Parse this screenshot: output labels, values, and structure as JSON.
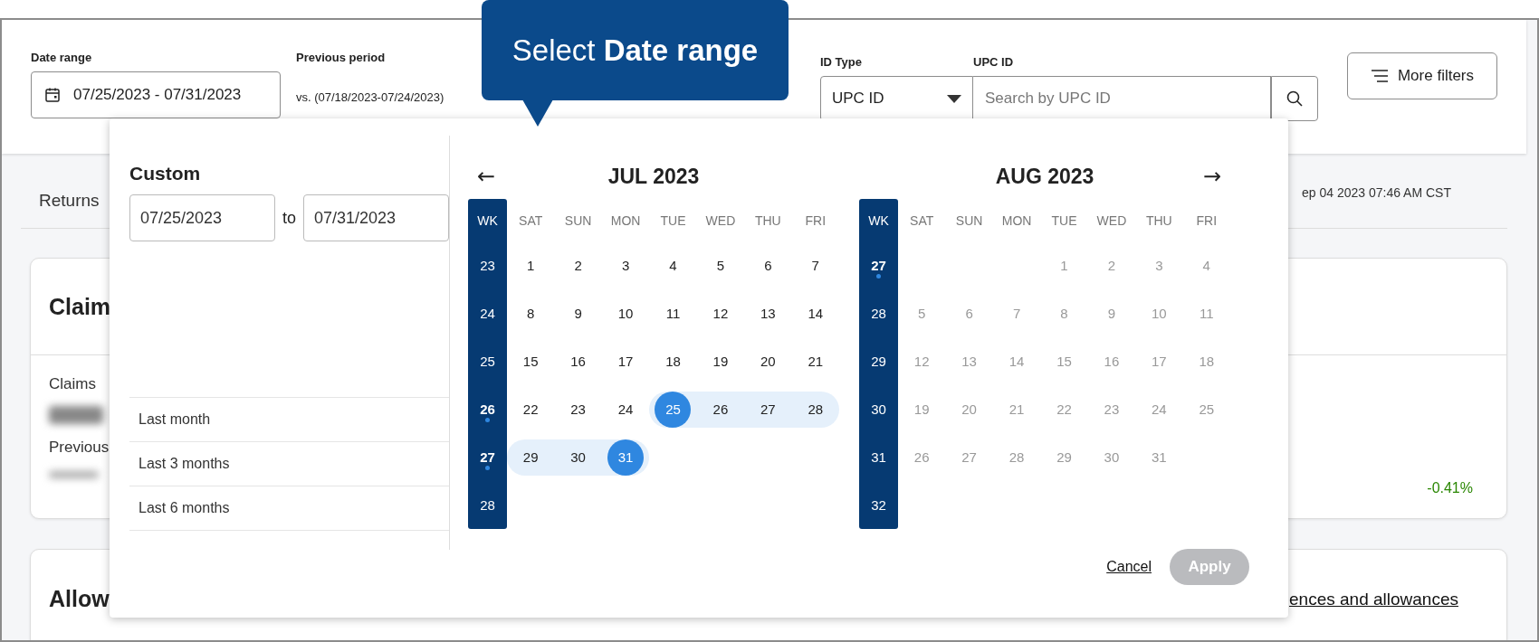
{
  "filters": {
    "date_range": {
      "label": "Date range",
      "value": "07/25/2023 - 07/31/2023"
    },
    "previous_period": {
      "label": "Previous period",
      "value": "vs. (07/18/2023-07/24/2023)"
    },
    "id_type": {
      "label": "ID Type",
      "value": "UPC ID"
    },
    "upc_id": {
      "label": "UPC ID",
      "placeholder": "Search by UPC ID"
    },
    "more_filters": "More filters"
  },
  "tooltip": "Select **Date range**",
  "tabs_row": {
    "tab": "Returns",
    "updated": "ep 04 2023 07:46 AM CST"
  },
  "claims_card": {
    "title": "Claim",
    "metric_label": "Claims",
    "previous_label": "Previous",
    "change": "-0.41%"
  },
  "allowances_card": {
    "title": "Allow",
    "link": "ences and allowances"
  },
  "date_picker": {
    "custom_title": "Custom",
    "from": "07/25/2023",
    "to_label": "to",
    "to": "07/31/2023",
    "presets": [
      {
        "label": "Last month",
        "selected": false
      },
      {
        "label": "Last 3 months",
        "selected": false
      },
      {
        "label": "Last 6 months",
        "selected": false
      }
    ],
    "months": [
      {
        "title": "JUL 2023",
        "nav": {
          "kind": "prev",
          "label": "←"
        },
        "week_header": "WK",
        "weekdays": [
          "SAT",
          "SUN",
          "MON",
          "TUE",
          "WED",
          "THU",
          "FRI"
        ],
        "weeks": [
          {
            "number": "23",
            "current": false,
            "days": [
              {
                "kind": "day",
                "label": "1",
                "selected": false,
                "in_range": false,
                "disabled": false
              },
              {
                "kind": "day",
                "label": "2",
                "selected": false,
                "in_range": false,
                "disabled": false
              },
              {
                "kind": "day",
                "label": "3",
                "selected": false,
                "in_range": false,
                "disabled": false
              },
              {
                "kind": "day",
                "label": "4",
                "selected": false,
                "in_range": false,
                "disabled": false
              },
              {
                "kind": "day",
                "label": "5",
                "selected": false,
                "in_range": false,
                "disabled": false
              },
              {
                "kind": "day",
                "label": "6",
                "selected": false,
                "in_range": false,
                "disabled": false
              },
              {
                "kind": "day",
                "label": "7",
                "selected": false,
                "in_range": false,
                "disabled": false
              }
            ]
          },
          {
            "number": "24",
            "current": false,
            "days": [
              {
                "kind": "day",
                "label": "8",
                "selected": false,
                "in_range": false,
                "disabled": false
              },
              {
                "kind": "day",
                "label": "9",
                "selected": false,
                "in_range": false,
                "disabled": false
              },
              {
                "kind": "day",
                "label": "10",
                "selected": false,
                "in_range": false,
                "disabled": false
              },
              {
                "kind": "day",
                "label": "11",
                "selected": false,
                "in_range": false,
                "disabled": false
              },
              {
                "kind": "day",
                "label": "12",
                "selected": false,
                "in_range": false,
                "disabled": false
              },
              {
                "kind": "day",
                "label": "13",
                "selected": false,
                "in_range": false,
                "disabled": false
              },
              {
                "kind": "day",
                "label": "14",
                "selected": false,
                "in_range": false,
                "disabled": false
              }
            ]
          },
          {
            "number": "25",
            "current": false,
            "days": [
              {
                "kind": "day",
                "label": "15",
                "selected": false,
                "in_range": false,
                "disabled": false
              },
              {
                "kind": "day",
                "label": "16",
                "selected": false,
                "in_range": false,
                "disabled": false
              },
              {
                "kind": "day",
                "label": "17",
                "selected": false,
                "in_range": false,
                "disabled": false
              },
              {
                "kind": "day",
                "label": "18",
                "selected": false,
                "in_range": false,
                "disabled": false
              },
              {
                "kind": "day",
                "label": "19",
                "selected": false,
                "in_range": false,
                "disabled": false
              },
              {
                "kind": "day",
                "label": "20",
                "selected": false,
                "in_range": false,
                "disabled": false
              },
              {
                "kind": "day",
                "label": "21",
                "selected": false,
                "in_range": false,
                "disabled": false
              }
            ]
          },
          {
            "number": "26",
            "current": true,
            "days": [
              {
                "kind": "day",
                "label": "22",
                "selected": false,
                "in_range": false,
                "disabled": false
              },
              {
                "kind": "day",
                "label": "23",
                "selected": false,
                "in_range": false,
                "disabled": false
              },
              {
                "kind": "day",
                "label": "24",
                "selected": false,
                "in_range": false,
                "disabled": false
              },
              {
                "kind": "day",
                "label": "25",
                "selected": true,
                "in_range": true,
                "disabled": false
              },
              {
                "kind": "day",
                "label": "26",
                "selected": false,
                "in_range": true,
                "disabled": false
              },
              {
                "kind": "day",
                "label": "27",
                "selected": false,
                "in_range": true,
                "disabled": false
              },
              {
                "kind": "day",
                "label": "28",
                "selected": false,
                "in_range": true,
                "disabled": false
              }
            ]
          },
          {
            "number": "27",
            "current": true,
            "days": [
              {
                "kind": "day",
                "label": "29",
                "selected": false,
                "in_range": true,
                "disabled": false
              },
              {
                "kind": "day",
                "label": "30",
                "selected": false,
                "in_range": true,
                "disabled": false
              },
              {
                "kind": "day",
                "label": "31",
                "selected": true,
                "in_range": true,
                "disabled": false
              }
            ]
          },
          {
            "number": "28",
            "current": false
          }
        ]
      },
      {
        "title": "AUG 2023",
        "nav": {
          "kind": "next",
          "label": "→"
        },
        "week_header": "WK",
        "weekdays": [
          "SAT",
          "SUN",
          "MON",
          "TUE",
          "WED",
          "THU",
          "FRI"
        ],
        "weeks": [
          {
            "number": "27",
            "current": true,
            "days": [
              {
                "kind": "blank"
              },
              {
                "kind": "blank"
              },
              {
                "kind": "blank"
              },
              {
                "kind": "day",
                "label": "1",
                "selected": false,
                "in_range": false,
                "disabled": true
              },
              {
                "kind": "day",
                "label": "2",
                "selected": false,
                "in_range": false,
                "disabled": true
              },
              {
                "kind": "day",
                "label": "3",
                "selected": false,
                "in_range": false,
                "disabled": true
              },
              {
                "kind": "day",
                "label": "4",
                "selected": false,
                "in_range": false,
                "disabled": true
              }
            ]
          },
          {
            "number": "28",
            "current": false,
            "days": [
              {
                "kind": "day",
                "label": "5",
                "selected": false,
                "in_range": false,
                "disabled": true
              },
              {
                "kind": "day",
                "label": "6",
                "selected": false,
                "in_range": false,
                "disabled": true
              },
              {
                "kind": "day",
                "label": "7",
                "selected": false,
                "in_range": false,
                "disabled": true
              },
              {
                "kind": "day",
                "label": "8",
                "selected": false,
                "in_range": false,
                "disabled": true
              },
              {
                "kind": "day",
                "label": "9",
                "selected": false,
                "in_range": false,
                "disabled": true
              },
              {
                "kind": "day",
                "label": "10",
                "selected": false,
                "in_range": false,
                "disabled": true
              },
              {
                "kind": "day",
                "label": "11",
                "selected": false,
                "in_range": false,
                "disabled": true
              }
            ]
          },
          {
            "number": "29",
            "current": false,
            "days": [
              {
                "kind": "day",
                "label": "12",
                "selected": false,
                "in_range": false,
                "disabled": true
              },
              {
                "kind": "day",
                "label": "13",
                "selected": false,
                "in_range": false,
                "disabled": true
              },
              {
                "kind": "day",
                "label": "14",
                "selected": false,
                "in_range": false,
                "disabled": true
              },
              {
                "kind": "day",
                "label": "15",
                "selected": false,
                "in_range": false,
                "disabled": true
              },
              {
                "kind": "day",
                "label": "16",
                "selected": false,
                "in_range": false,
                "disabled": true
              },
              {
                "kind": "day",
                "label": "17",
                "selected": false,
                "in_range": false,
                "disabled": true
              },
              {
                "kind": "day",
                "label": "18",
                "selected": false,
                "in_range": false,
                "disabled": true
              }
            ]
          },
          {
            "number": "30",
            "current": false,
            "days": [
              {
                "kind": "day",
                "label": "19",
                "selected": false,
                "in_range": false,
                "disabled": true
              },
              {
                "kind": "day",
                "label": "20",
                "selected": false,
                "in_range": false,
                "disabled": true
              },
              {
                "kind": "day",
                "label": "21",
                "selected": false,
                "in_range": false,
                "disabled": true
              },
              {
                "kind": "day",
                "label": "22",
                "selected": false,
                "in_range": false,
                "disabled": true
              },
              {
                "kind": "day",
                "label": "23",
                "selected": false,
                "in_range": false,
                "disabled": true
              },
              {
                "kind": "day",
                "label": "24",
                "selected": false,
                "in_range": false,
                "disabled": true
              },
              {
                "kind": "day",
                "label": "25",
                "selected": false,
                "in_range": false,
                "disabled": true
              }
            ]
          },
          {
            "number": "31",
            "current": false,
            "days": [
              {
                "kind": "day",
                "label": "26",
                "selected": false,
                "in_range": false,
                "disabled": true
              },
              {
                "kind": "day",
                "label": "27",
                "selected": false,
                "in_range": false,
                "disabled": true
              },
              {
                "kind": "day",
                "label": "28",
                "selected": false,
                "in_range": false,
                "disabled": true
              },
              {
                "kind": "day",
                "label": "29",
                "selected": false,
                "in_range": false,
                "disabled": true
              },
              {
                "kind": "day",
                "label": "30",
                "selected": false,
                "in_range": false,
                "disabled": true
              },
              {
                "kind": "day",
                "label": "31",
                "selected": false,
                "in_range": false,
                "disabled": true
              }
            ]
          },
          {
            "number": "32",
            "current": false
          }
        ]
      }
    ],
    "cancel": "Cancel",
    "apply": {
      "label": "Apply",
      "disabled": true
    }
  }
}
